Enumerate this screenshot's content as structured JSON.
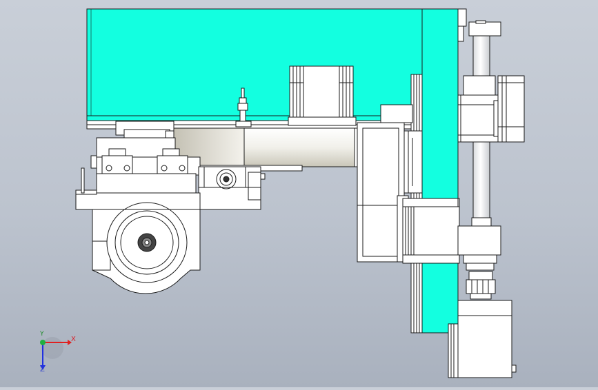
{
  "viewport": {
    "background_top": "#c9cfd8",
    "background_bottom": "#a9b1be",
    "highlight_color": "#13ffe0",
    "part_color": "#ffffff",
    "edge_color": "#1a1a1a"
  },
  "triad": {
    "x_label": "X",
    "y_label": "Y",
    "z_label": "Z",
    "x_color": "#e02020",
    "y_color": "#20a020",
    "z_color": "#2030e0"
  }
}
